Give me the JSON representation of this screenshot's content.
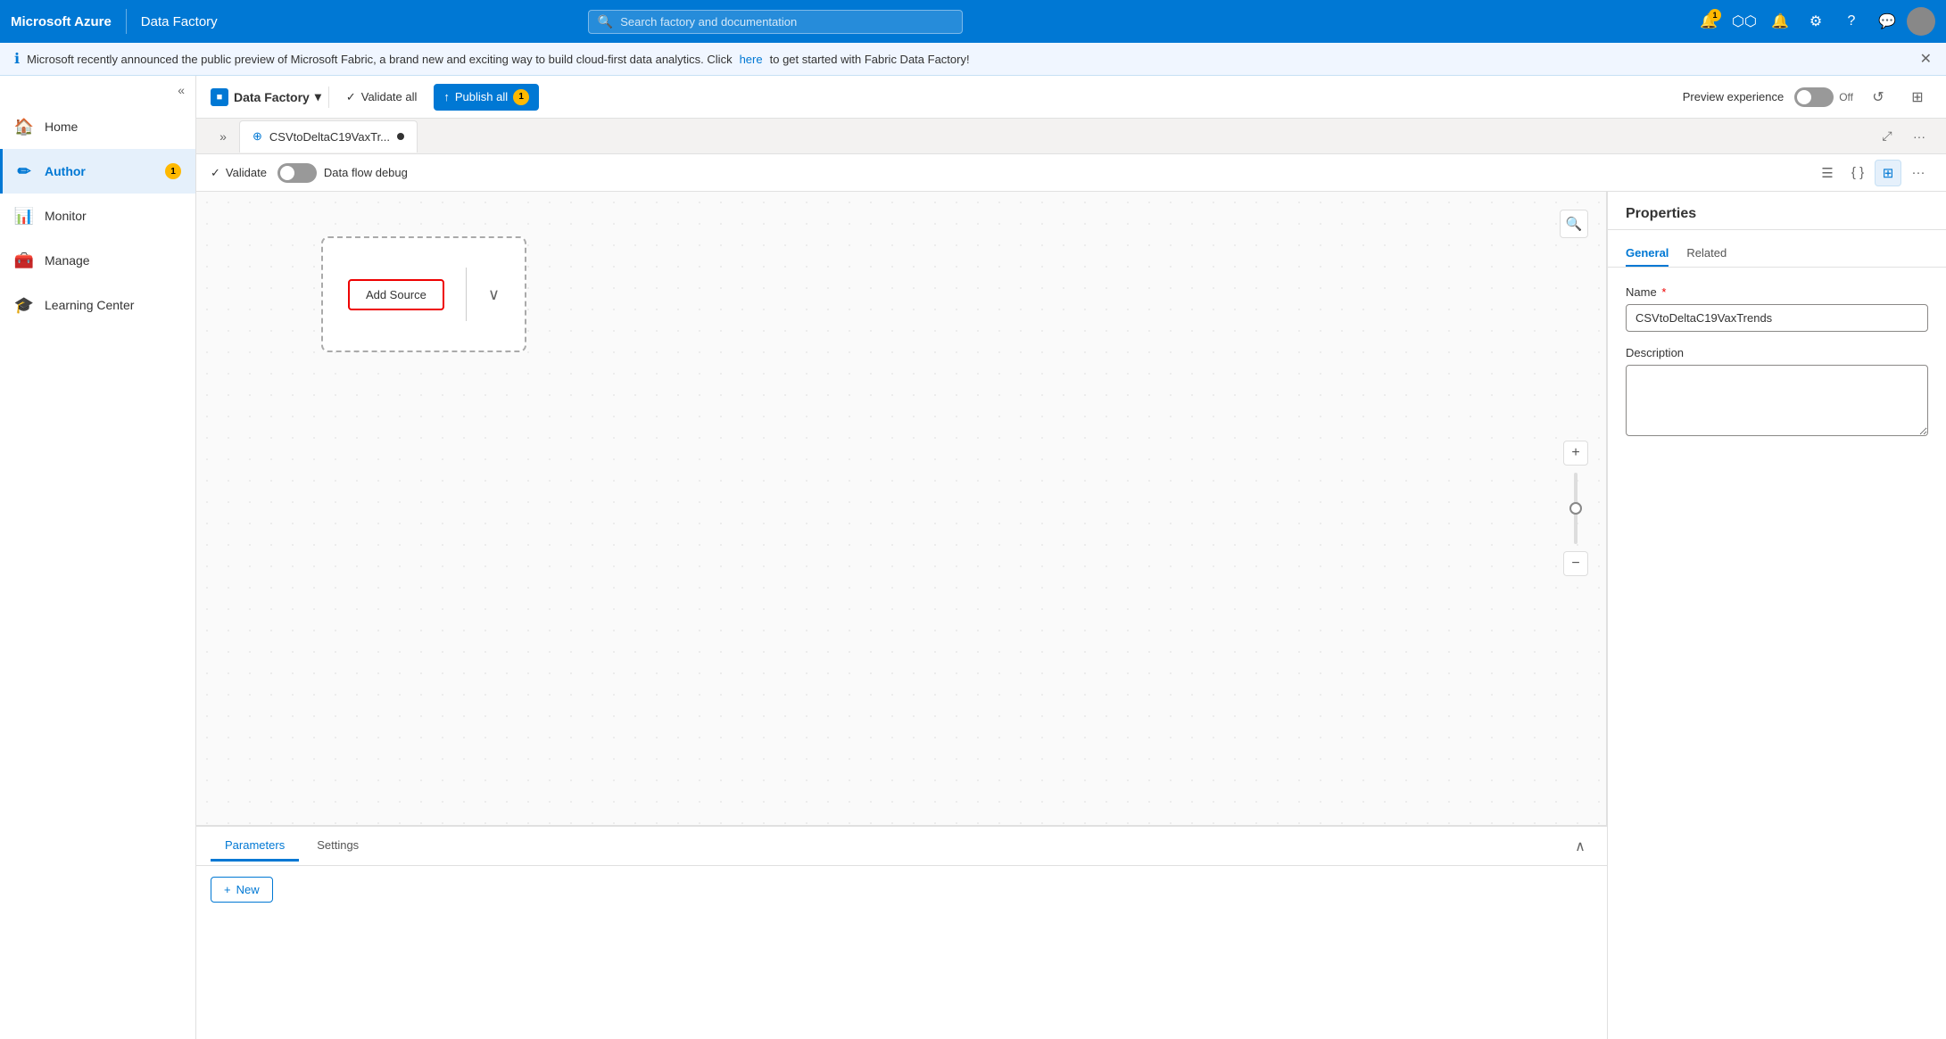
{
  "topnav": {
    "brand": "Microsoft Azure",
    "app_name": "Data Factory",
    "search_placeholder": "Search factory and documentation",
    "icons": [
      {
        "name": "notifications-icon",
        "symbol": "🔔",
        "badge": "1"
      },
      {
        "name": "cloud-icon",
        "symbol": "⬡"
      },
      {
        "name": "bell-icon",
        "symbol": "🔔"
      },
      {
        "name": "settings-icon",
        "symbol": "⚙"
      },
      {
        "name": "help-icon",
        "symbol": "?"
      },
      {
        "name": "feedback-icon",
        "symbol": "💬"
      }
    ]
  },
  "banner": {
    "message": "Microsoft recently announced the public preview of Microsoft Fabric, a brand new and exciting way to build cloud-first data analytics. Click",
    "link_text": "here",
    "message_suffix": "to get started with Fabric Data Factory!"
  },
  "toolbar": {
    "brand_label": "Data Factory",
    "validate_all_label": "Validate all",
    "publish_all_label": "Publish all",
    "publish_badge": "1",
    "preview_experience_label": "Preview experience",
    "toggle_off_label": "Off"
  },
  "tab": {
    "label": "CSVtoDeltaC19VaxTr...",
    "has_unsaved": true
  },
  "sub_toolbar": {
    "validate_label": "Validate",
    "debug_label": "Data flow debug"
  },
  "canvas": {
    "add_source_label": "Add Source"
  },
  "bottom_panel": {
    "tabs": [
      {
        "label": "Parameters",
        "active": true
      },
      {
        "label": "Settings",
        "active": false
      }
    ],
    "new_button_label": "New",
    "collapse_icon": "∧"
  },
  "properties": {
    "title": "Properties",
    "tabs": [
      {
        "label": "General",
        "active": true
      },
      {
        "label": "Related",
        "active": false
      }
    ],
    "name_label": "Name",
    "name_required": true,
    "name_value": "CSVtoDeltaC19VaxTrends",
    "description_label": "Description",
    "description_value": ""
  },
  "sidebar": {
    "items": [
      {
        "label": "Home",
        "icon": "🏠",
        "name": "home",
        "active": false
      },
      {
        "label": "Author",
        "icon": "✏",
        "name": "author",
        "active": true,
        "badge": "1"
      },
      {
        "label": "Monitor",
        "icon": "📊",
        "name": "monitor",
        "active": false
      },
      {
        "label": "Manage",
        "icon": "🧰",
        "name": "manage",
        "active": false
      },
      {
        "label": "Learning Center",
        "icon": "🎓",
        "name": "learning-center",
        "active": false
      }
    ]
  }
}
